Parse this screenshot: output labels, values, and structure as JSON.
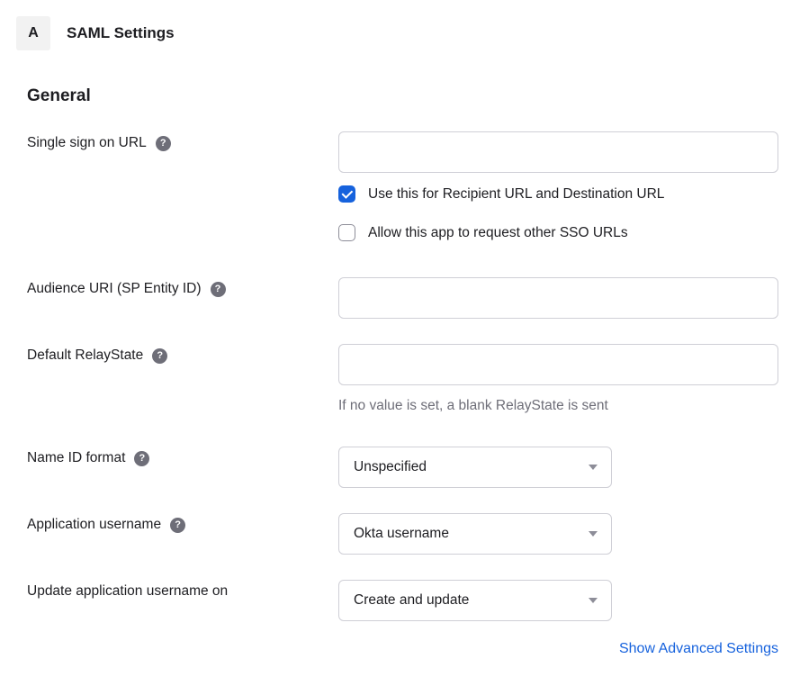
{
  "header": {
    "badge": "A",
    "title": "SAML Settings"
  },
  "section": {
    "title": "General"
  },
  "fields": {
    "sso_url": {
      "label": "Single sign on URL",
      "value": "",
      "checkbox_recipient": "Use this for Recipient URL and Destination URL",
      "checkbox_other_sso": "Allow this app to request other SSO URLs"
    },
    "audience_uri": {
      "label": "Audience URI (SP Entity ID)",
      "value": ""
    },
    "relay_state": {
      "label": "Default RelayState",
      "value": "",
      "helper": "If no value is set, a blank RelayState is sent"
    },
    "name_id_format": {
      "label": "Name ID format",
      "selected": "Unspecified"
    },
    "app_username": {
      "label": "Application username",
      "selected": "Okta username"
    },
    "update_username_on": {
      "label": "Update application username on",
      "selected": "Create and update"
    }
  },
  "footer": {
    "advanced_link": "Show Advanced Settings"
  }
}
